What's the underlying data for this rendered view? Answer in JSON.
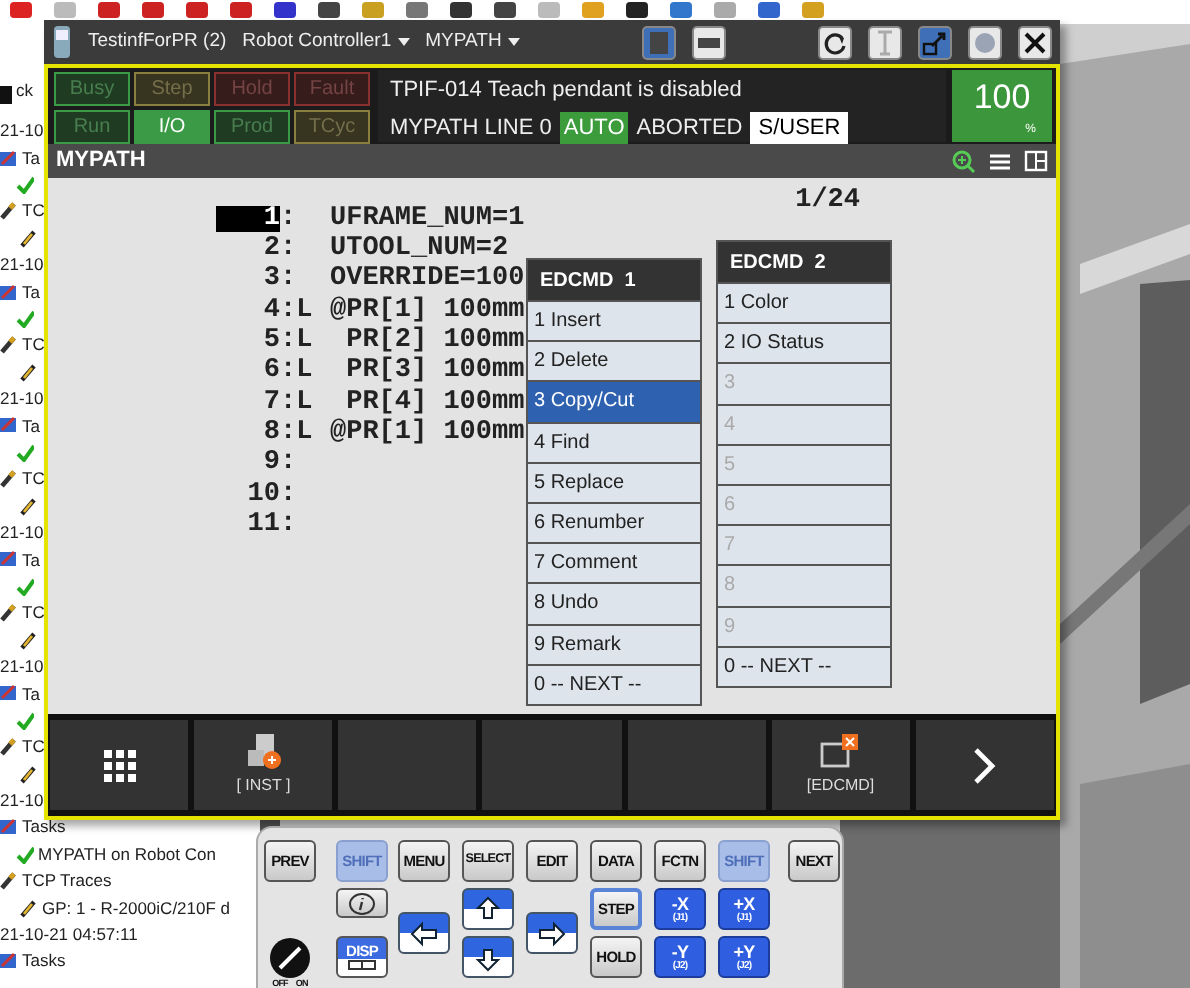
{
  "side_toolbar": {
    "label": "ck"
  },
  "tree": [
    {
      "label": "21-10",
      "children": [
        {
          "label": "Ta",
          "kind": "tasks",
          "children": [
            {
              "kind": "done"
            }
          ]
        },
        {
          "label": "TC",
          "kind": "traces",
          "children": [
            {
              "kind": "trace"
            }
          ]
        }
      ]
    },
    {
      "label": "21-10",
      "children": [
        {
          "label": "Ta",
          "kind": "tasks",
          "children": [
            {
              "kind": "done"
            }
          ]
        },
        {
          "label": "TC",
          "kind": "traces",
          "children": [
            {
              "kind": "trace"
            }
          ]
        }
      ]
    },
    {
      "label": "21-10",
      "children": [
        {
          "label": "Ta",
          "kind": "tasks",
          "children": [
            {
              "kind": "done"
            }
          ]
        },
        {
          "label": "TC",
          "kind": "traces",
          "children": [
            {
              "kind": "trace"
            }
          ]
        }
      ]
    },
    {
      "label": "21-10",
      "children": [
        {
          "label": "Ta",
          "kind": "tasks",
          "children": [
            {
              "kind": "done"
            }
          ]
        },
        {
          "label": "TC",
          "kind": "traces",
          "children": [
            {
              "kind": "trace"
            }
          ]
        }
      ]
    },
    {
      "label": "21-10",
      "children": [
        {
          "label": "Ta",
          "kind": "tasks",
          "children": [
            {
              "kind": "done"
            }
          ]
        },
        {
          "label": "TC",
          "kind": "traces",
          "children": [
            {
              "kind": "trace"
            }
          ]
        }
      ]
    },
    {
      "label": "21-10",
      "children": [
        {
          "label": "Tasks",
          "kind": "tasks",
          "children": [
            {
              "label": "MYPATH on Robot Con",
              "kind": "done"
            }
          ]
        },
        {
          "label": "TCP Traces",
          "kind": "traces",
          "children": [
            {
              "label": "GP: 1 - R-2000iC/210F d",
              "kind": "trace"
            }
          ]
        }
      ]
    },
    {
      "label": "21-10-21 04:57:11",
      "children": [
        {
          "label": "Tasks",
          "kind": "tasks"
        }
      ]
    }
  ],
  "pendant": {
    "title_items": [
      {
        "label": "TestinfForPR (2)",
        "dropdown": false
      },
      {
        "label": "Robot Controller1",
        "dropdown": true
      },
      {
        "label": "MYPATH",
        "dropdown": true
      }
    ],
    "lamps": [
      {
        "label": "Busy",
        "color": "#3a9a45",
        "on": false
      },
      {
        "label": "Step",
        "color": "#8a7f3c",
        "on": false
      },
      {
        "label": "Hold",
        "color": "#8a3030",
        "on": false
      },
      {
        "label": "Fault",
        "color": "#8a3030",
        "on": false
      },
      {
        "label": "Run",
        "color": "#3a9a45",
        "on": false
      },
      {
        "label": "I/O",
        "color": "#3a9a45",
        "on": true
      },
      {
        "label": "Prod",
        "color": "#3a9a45",
        "on": false
      },
      {
        "label": "TCyc",
        "color": "#8a7f3c",
        "on": false
      }
    ],
    "message": "TPIF-014 Teach pendant is disabled",
    "status": [
      {
        "label": "MYPATH LINE 0",
        "kind": "plain"
      },
      {
        "label": "AUTO",
        "kind": "green"
      },
      {
        "label": "ABORTED",
        "kind": "plain"
      },
      {
        "label": "S/USER",
        "kind": "boxed"
      }
    ],
    "override": {
      "value": "100",
      "unit": "%"
    },
    "screen_title": "MYPATH",
    "line_counter": "1/24",
    "lines": [
      {
        "number": "1",
        "mark": ":",
        "code": "UFRAME_NUM=1",
        "cursor": true
      },
      {
        "number": "2",
        "mark": ":",
        "code": "UTOOL_NUM=2",
        "cursor": false
      },
      {
        "number": "3",
        "mark": ":",
        "code": "OVERRIDE=100",
        "cursor": false
      },
      {
        "number": "4",
        "mark": ":L",
        "code": "@PR[1] 100mm",
        "cursor": false
      },
      {
        "number": "5",
        "mark": ":L",
        "code": " PR[2] 100mm",
        "cursor": false
      },
      {
        "number": "6",
        "mark": ":L",
        "code": " PR[3] 100mm",
        "cursor": false
      },
      {
        "number": "7",
        "mark": ":L",
        "code": " PR[4] 100mm",
        "cursor": false
      },
      {
        "number": "8",
        "mark": ":L",
        "code": "@PR[1] 100mm",
        "cursor": false
      },
      {
        "number": "9",
        "mark": ":",
        "cursor": false
      },
      {
        "number": "10",
        "mark": ":",
        "cursor": false
      },
      {
        "number": "11",
        "mark": ":",
        "cursor": false
      }
    ],
    "menus": [
      {
        "title": "EDCMD  1",
        "items": [
          {
            "label": "1 Insert",
            "selected": false,
            "disabled": false
          },
          {
            "label": "2 Delete",
            "selected": false,
            "disabled": false
          },
          {
            "label": "3 Copy/Cut",
            "selected": true,
            "disabled": false
          },
          {
            "label": "4 Find",
            "selected": false,
            "disabled": false
          },
          {
            "label": "5 Replace",
            "selected": false,
            "disabled": false
          },
          {
            "label": "6 Renumber",
            "selected": false,
            "disabled": false
          },
          {
            "label": "7 Comment",
            "selected": false,
            "disabled": false
          },
          {
            "label": "8 Undo",
            "selected": false,
            "disabled": false
          },
          {
            "label": "9 Remark",
            "selected": false,
            "disabled": false
          },
          {
            "label": "0 -- NEXT --",
            "selected": false,
            "disabled": false
          }
        ]
      },
      {
        "title": "EDCMD  2",
        "items": [
          {
            "label": "1 Color",
            "selected": false,
            "disabled": false
          },
          {
            "label": "2 IO Status",
            "selected": false,
            "disabled": false
          },
          {
            "label": "3",
            "selected": false,
            "disabled": true
          },
          {
            "label": "4",
            "selected": false,
            "disabled": true
          },
          {
            "label": "5",
            "selected": false,
            "disabled": true
          },
          {
            "label": "6",
            "selected": false,
            "disabled": true
          },
          {
            "label": "7",
            "selected": false,
            "disabled": true
          },
          {
            "label": "8",
            "selected": false,
            "disabled": true
          },
          {
            "label": "9",
            "selected": false,
            "disabled": true
          },
          {
            "label": "0 -- NEXT --",
            "selected": false,
            "disabled": false
          }
        ]
      }
    ],
    "function_keys": [
      {
        "kind": "grid"
      },
      {
        "kind": "inst",
        "label": "[ INST ]"
      },
      {
        "kind": "empty"
      },
      {
        "kind": "empty"
      },
      {
        "kind": "empty"
      },
      {
        "kind": "edcmd",
        "label": "[EDCMD]"
      },
      {
        "kind": "next"
      }
    ]
  },
  "keypad": [
    {
      "kind": "key",
      "label": "PREV"
    },
    {
      "kind": "shift",
      "label": "SHIFT",
      "disabled": true
    },
    {
      "kind": "key",
      "label": "MENU"
    },
    {
      "kind": "key",
      "label": "SELECT"
    },
    {
      "kind": "key",
      "label": "EDIT"
    },
    {
      "kind": "key",
      "label": "DATA"
    },
    {
      "kind": "key",
      "label": "FCTN"
    },
    {
      "kind": "shift",
      "label": "SHIFT",
      "disabled": true
    },
    {
      "kind": "key",
      "label": "NEXT"
    },
    {
      "kind": "info"
    },
    {
      "kind": "left"
    },
    {
      "kind": "up"
    },
    {
      "kind": "down"
    },
    {
      "kind": "right"
    },
    {
      "kind": "step",
      "label": "STEP"
    },
    {
      "kind": "jog",
      "label": "-X",
      "sub": "(J1)"
    },
    {
      "kind": "jog",
      "label": "+X",
      "sub": "(J1)"
    },
    {
      "kind": "disp",
      "label": "DISP"
    },
    {
      "kind": "key",
      "label": "HOLD"
    },
    {
      "kind": "jog",
      "label": "-Y",
      "sub": "(J2)"
    },
    {
      "kind": "jog",
      "label": "+Y",
      "sub": "(J2)"
    },
    {
      "kind": "switch",
      "off": "OFF",
      "on": "ON"
    }
  ]
}
